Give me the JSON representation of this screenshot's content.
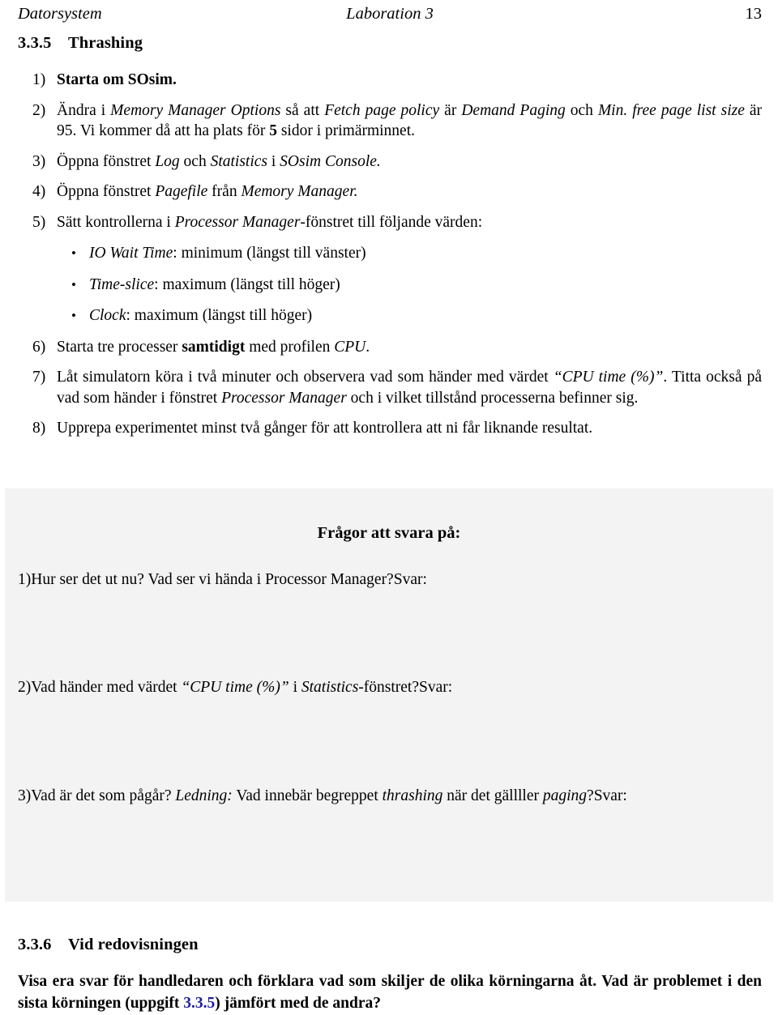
{
  "header": {
    "left": "Datorsystem",
    "center": "Laboration 3",
    "page_number": "13"
  },
  "sections": {
    "thrashing": {
      "number": "3.3.5",
      "title": "Thrashing"
    },
    "redovisning": {
      "number": "3.3.6",
      "title": "Vid redovisningen"
    }
  },
  "steps": [
    {
      "marker": "1)",
      "text_parts": [
        {
          "style": "bold",
          "text": "Starta om SOsim."
        }
      ]
    },
    {
      "marker": "2)",
      "text_parts": [
        {
          "style": "normal",
          "text": "Ändra i "
        },
        {
          "style": "italic",
          "text": "Memory Manager Options"
        },
        {
          "style": "normal",
          "text": " så att "
        },
        {
          "style": "italic",
          "text": "Fetch page policy"
        },
        {
          "style": "normal",
          "text": " är "
        },
        {
          "style": "italic",
          "text": "Demand Paging"
        },
        {
          "style": "normal",
          "text": " och "
        },
        {
          "style": "italic",
          "text": "Min. free page list size"
        },
        {
          "style": "normal",
          "text": " är 95. Vi kommer då att ha plats för "
        },
        {
          "style": "bold",
          "text": "5"
        },
        {
          "style": "normal",
          "text": " sidor i primärminnet."
        }
      ]
    },
    {
      "marker": "3)",
      "text_parts": [
        {
          "style": "normal",
          "text": "Öppna fönstret "
        },
        {
          "style": "italic",
          "text": "Log"
        },
        {
          "style": "normal",
          "text": " och "
        },
        {
          "style": "italic",
          "text": "Statistics"
        },
        {
          "style": "normal",
          "text": " i "
        },
        {
          "style": "italic",
          "text": "SOsim Console."
        }
      ]
    },
    {
      "marker": "4)",
      "text_parts": [
        {
          "style": "normal",
          "text": "Öppna fönstret "
        },
        {
          "style": "italic",
          "text": "Pagefile"
        },
        {
          "style": "normal",
          "text": " från "
        },
        {
          "style": "italic",
          "text": "Memory Manager."
        }
      ]
    },
    {
      "marker": "5)",
      "text_parts": [
        {
          "style": "normal",
          "text": "Sätt kontrollerna i "
        },
        {
          "style": "italic",
          "text": "Processor Manager"
        },
        {
          "style": "normal",
          "text": "-fönstret till följande värden:"
        }
      ],
      "bullets": [
        [
          {
            "style": "italic",
            "text": "IO Wait Time"
          },
          {
            "style": "normal",
            "text": ": minimum (längst till vänster)"
          }
        ],
        [
          {
            "style": "italic",
            "text": "Time-slice"
          },
          {
            "style": "normal",
            "text": ": maximum (längst till höger)"
          }
        ],
        [
          {
            "style": "italic",
            "text": "Clock"
          },
          {
            "style": "normal",
            "text": ": maximum (längst till höger)"
          }
        ]
      ]
    },
    {
      "marker": "6)",
      "text_parts": [
        {
          "style": "normal",
          "text": "Starta tre processer "
        },
        {
          "style": "bold",
          "text": "samtidigt"
        },
        {
          "style": "normal",
          "text": " med profilen "
        },
        {
          "style": "italic",
          "text": "CPU"
        },
        {
          "style": "normal",
          "text": "."
        }
      ]
    },
    {
      "marker": "7)",
      "text_parts": [
        {
          "style": "normal",
          "text": "Låt simulatorn köra i två minuter och observera vad som händer med värdet "
        },
        {
          "style": "italic",
          "text": "“CPU time (%)”"
        },
        {
          "style": "normal",
          "text": ". Titta också på vad som händer i fönstret "
        },
        {
          "style": "italic",
          "text": "Processor Manager"
        },
        {
          "style": "normal",
          "text": " och i vilket tillstånd processerna befinner sig."
        }
      ]
    },
    {
      "marker": "8)",
      "text_parts": [
        {
          "style": "normal",
          "text": "Upprepa experimentet minst två gånger för att kontrollera att ni får liknande resultat."
        }
      ]
    }
  ],
  "answer_panel": {
    "heading": "Frågor att svara på:",
    "answer_label": "Svar:",
    "questions": [
      {
        "marker": "1)",
        "text_parts": [
          {
            "style": "normal",
            "text": "Hur ser det ut nu? Vad ser vi hända i Processor Manager?"
          }
        ]
      },
      {
        "marker": "2)",
        "text_parts": [
          {
            "style": "normal",
            "text": "Vad händer med värdet "
          },
          {
            "style": "italic",
            "text": "“CPU time (%)”"
          },
          {
            "style": "normal",
            "text": " i "
          },
          {
            "style": "italic",
            "text": "Statistics"
          },
          {
            "style": "normal",
            "text": "-fönstret?"
          }
        ]
      },
      {
        "marker": "3)",
        "text_parts": [
          {
            "style": "normal",
            "text": "Vad är det som pågår? "
          },
          {
            "style": "italic",
            "text": "Ledning:"
          },
          {
            "style": "normal",
            "text": " Vad innebär begreppet "
          },
          {
            "style": "italic",
            "text": "thrashing"
          },
          {
            "style": "normal",
            "text": " när det gällller "
          },
          {
            "style": "italic",
            "text": "paging"
          },
          {
            "style": "normal",
            "text": "?"
          }
        ]
      }
    ]
  },
  "final_paragraph": {
    "parts": [
      {
        "style": "bold",
        "text": "Visa era svar för handledaren och förklara vad som skiljer de olika körningarna åt. Vad är problemet i den sista körningen (uppgift "
      },
      {
        "style": "xref",
        "text": "3.3.5"
      },
      {
        "style": "bold",
        "text": ") jämfört med de andra?"
      }
    ]
  },
  "colors": {
    "panel_background": "#f3f3f3",
    "page_background": "#ffffff",
    "text": "#000000",
    "cross_reference": "#1c1ca0"
  }
}
